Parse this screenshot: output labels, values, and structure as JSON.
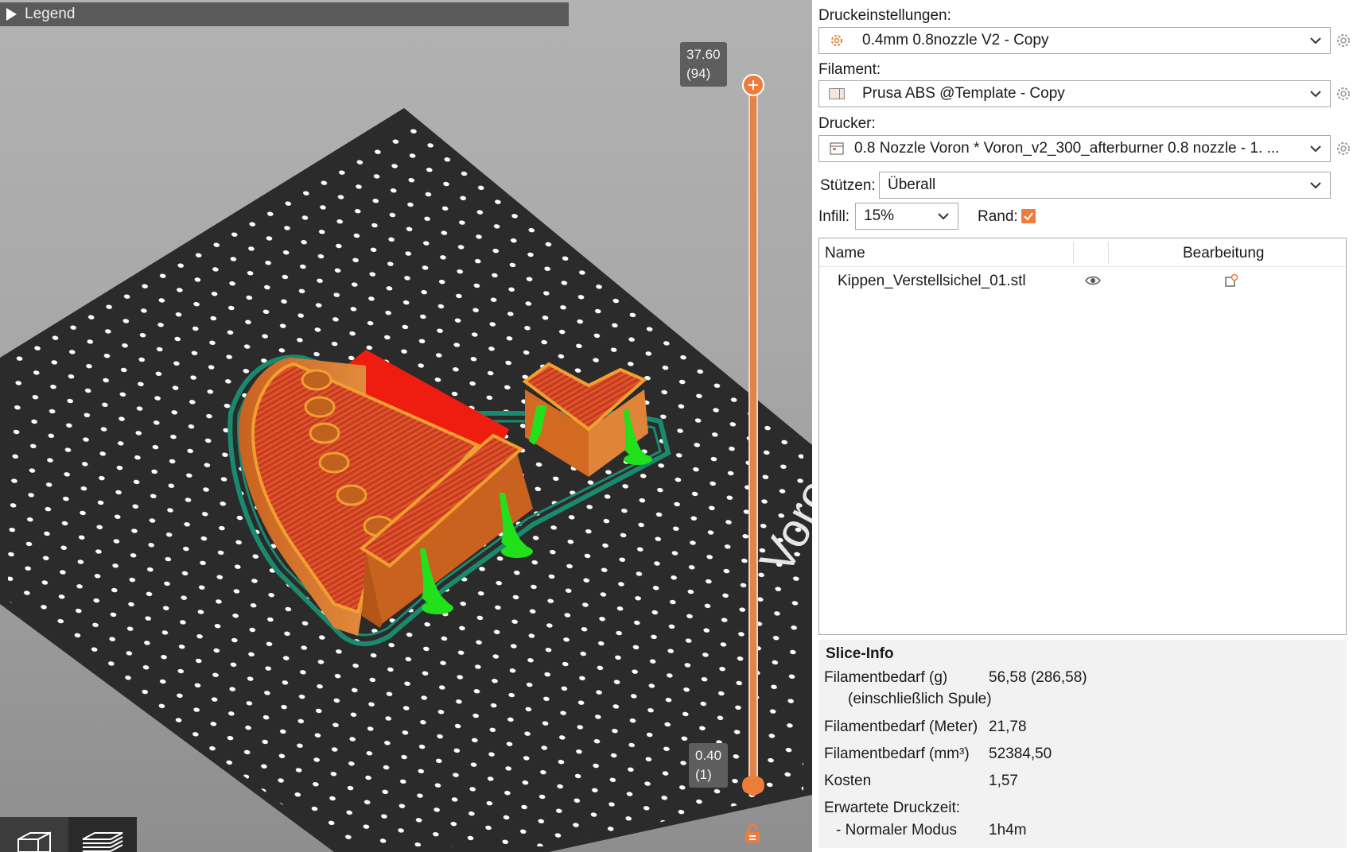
{
  "viewport": {
    "legend_label": "Legend",
    "slider": {
      "top_value": "37.60",
      "top_layer": "(94)",
      "bottom_value": "0.40",
      "bottom_layer": "(1)"
    },
    "bed_text": "Voron",
    "view_buttons": [
      "3d-view",
      "layer-view"
    ]
  },
  "panel": {
    "print_settings": {
      "label": "Druckeinstellungen:",
      "value": "0.4mm 0.8nozzle V2 - Copy"
    },
    "filament": {
      "label": "Filament:",
      "value": "Prusa ABS @Template - Copy"
    },
    "printer": {
      "label": "Drucker:",
      "value": "0.8 Nozzle Voron  * Voron_v2_300_afterburner 0.8 nozzle - 1. ..."
    },
    "supports": {
      "label": "Stützen:",
      "value": "Überall"
    },
    "infill": {
      "label": "Infill:",
      "value": "15%"
    },
    "brim": {
      "label": "Rand:",
      "checked": true
    },
    "object_list": {
      "col_name": "Name",
      "col_edit": "Bearbeitung",
      "objects": [
        {
          "name": "Kippen_Verstellsichel_01.stl"
        }
      ]
    },
    "slice_info": {
      "title": "Slice-Info",
      "rows": [
        {
          "label": "Filamentbedarf (g)",
          "value": "56,58 (286,58)"
        },
        {
          "label": "(einschließlich Spule)",
          "value": ""
        },
        {
          "label": "Filamentbedarf (Meter)",
          "value": "21,78"
        },
        {
          "label": "Filamentbedarf (mm³)",
          "value": "52384,50"
        },
        {
          "label": "Kosten",
          "value": "1,57"
        },
        {
          "label": "Erwartete Druckzeit:",
          "value": ""
        },
        {
          "label": "- Normaler Modus",
          "value": "1h4m"
        }
      ]
    }
  },
  "colors": {
    "accent": "#ee7d3c",
    "bed": "#2b2b2b",
    "model_orange": "#d9772e",
    "model_red": "#e8231c",
    "support_green": "#22e01a",
    "brim_teal": "#1a8a6e"
  }
}
